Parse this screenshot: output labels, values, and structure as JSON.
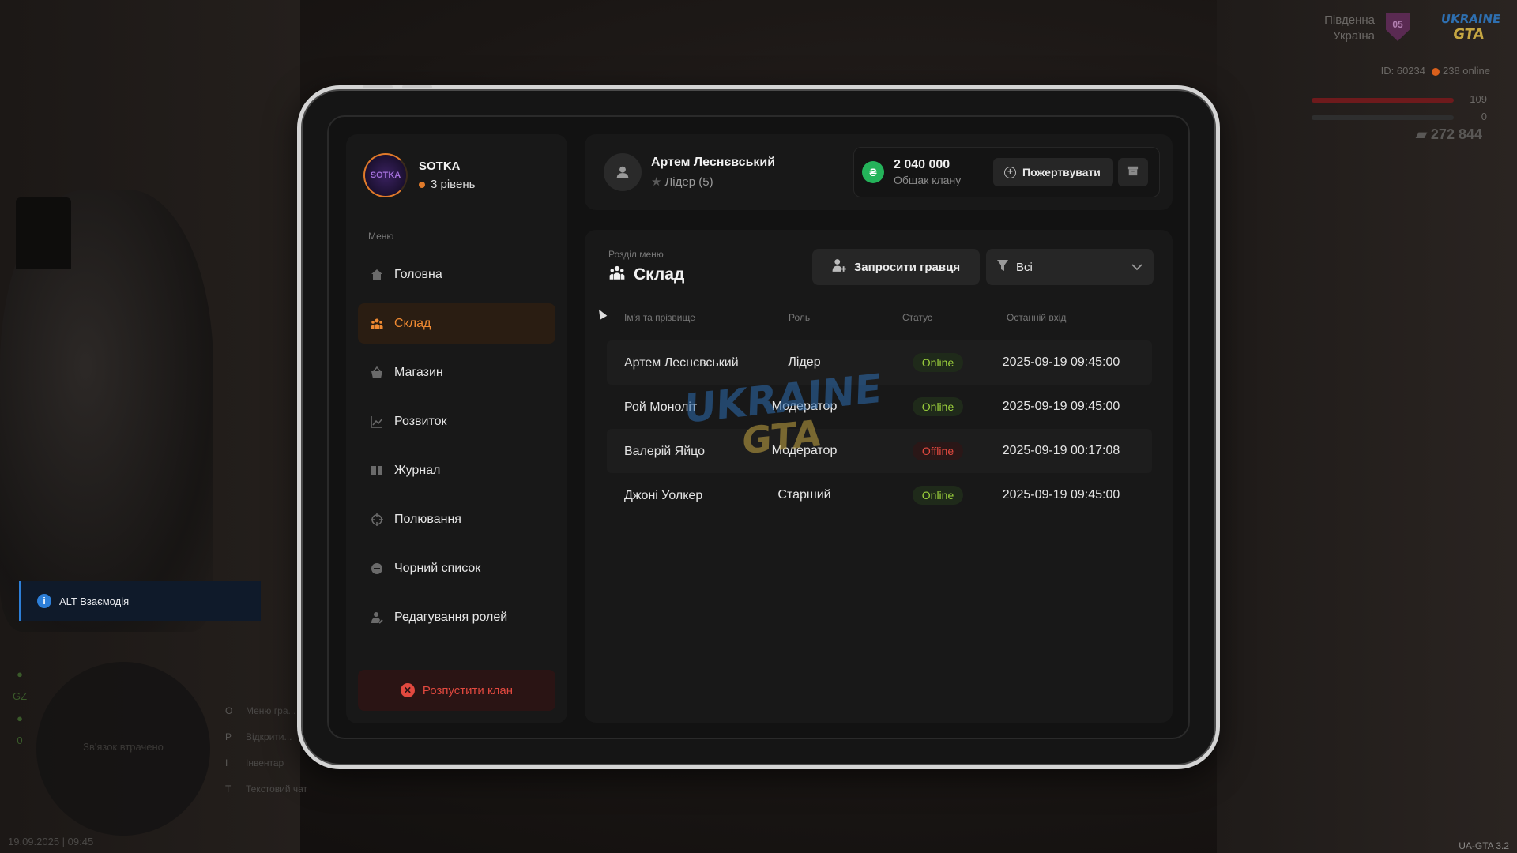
{
  "hud": {
    "region": "Південна Україна",
    "region_badge": "05",
    "logo_top": "UKRAINE",
    "logo_bottom": "GTA",
    "player_id": "ID: 60234",
    "online": "238 online",
    "hp": "109",
    "armor": "0",
    "money": "272 844",
    "interaction": "ALT Взаємодія",
    "minimap_text": "Зв'язок втрачено",
    "gz": "GZ",
    "gz_count": "0",
    "hints": [
      {
        "key": "O",
        "label": "Меню гра..."
      },
      {
        "key": "P",
        "label": "Відкрити..."
      },
      {
        "key": "I",
        "label": "Інвентар"
      },
      {
        "key": "T",
        "label": "Текстовий чат"
      }
    ],
    "datetime": "19.09.2025 | 09:45",
    "version": "UA-GTA 3.2"
  },
  "clan": {
    "name": "SOTKA",
    "level": "3 рівень",
    "logo_text": "SOTKA"
  },
  "sidebar": {
    "menu_title": "Меню",
    "items": [
      {
        "label": "Головна",
        "icon": "home-icon",
        "active": false
      },
      {
        "label": "Склад",
        "icon": "people-icon",
        "active": true
      },
      {
        "label": "Магазин",
        "icon": "basket-icon",
        "active": false
      },
      {
        "label": "Розвиток",
        "icon": "chart-icon",
        "active": false
      },
      {
        "label": "Журнал",
        "icon": "book-icon",
        "active": false
      },
      {
        "label": "Полювання",
        "icon": "crosshair-icon",
        "active": false
      },
      {
        "label": "Чорний список",
        "icon": "block-icon",
        "active": false
      },
      {
        "label": "Редагування ролей",
        "icon": "user-edit-icon",
        "active": false
      }
    ],
    "disband_label": "Розпустити клан"
  },
  "header": {
    "user_name": "Артем Леснєвський",
    "user_role": "Лідер (5)",
    "bank_amount": "2 040 000",
    "bank_label": "Общак клану",
    "currency_symbol": "₴",
    "donate_label": "Пожертвувати"
  },
  "main": {
    "section_sub": "Розділ меню",
    "section_title": "Склад",
    "invite_label": "Запросити гравця",
    "filter_value": "Всі",
    "columns": [
      "Ім'я та прізвище",
      "Роль",
      "Статус",
      "Останній вхід"
    ],
    "rows": [
      {
        "name": "Артем Леснєвський",
        "role": "Лідер",
        "status": "Online",
        "last": "2025-09-19 09:45:00"
      },
      {
        "name": "Рой Моноліт",
        "role": "Модератор",
        "status": "Online",
        "last": "2025-09-19 09:45:00"
      },
      {
        "name": "Валерій Яйцо",
        "role": "Модератор",
        "status": "Offline",
        "last": "2025-09-19 00:17:08"
      },
      {
        "name": "Джоні Уолкер",
        "role": "Старший",
        "status": "Online",
        "last": "2025-09-19 09:45:00"
      }
    ],
    "watermark_top": "UKRAINE",
    "watermark_bottom": "GTA"
  },
  "colors": {
    "accent": "#f08a32",
    "online": "#9cd13c",
    "offline": "#e2493f",
    "coin": "#24b35a"
  }
}
